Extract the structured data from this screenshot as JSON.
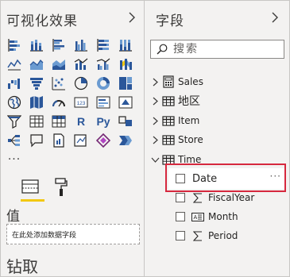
{
  "panels": {
    "visualizations_title": "可视化效果",
    "fields_title": "字段"
  },
  "visual_icons": [
    "stacked-bar-icon",
    "stacked-column-icon",
    "clustered-bar-icon",
    "clustered-column-icon",
    "100-percent-bar-icon",
    "100-percent-column-icon",
    "line-chart-icon",
    "area-chart-icon",
    "stacked-area-icon",
    "line-column-icon",
    "line-clustered-column-icon",
    "ribbon-chart-icon",
    "waterfall-icon",
    "funnel-icon",
    "scatter-icon",
    "pie-chart-icon",
    "donut-chart-icon",
    "treemap-icon",
    "map-icon",
    "filled-map-icon",
    "gauge-icon",
    "card-icon",
    "multi-row-card-icon",
    "kpi-icon",
    "slicer-icon",
    "table-icon",
    "matrix-icon",
    "r-visual",
    "python-visual",
    "key-influencers-icon",
    "decomposition-tree-icon",
    "qa-icon",
    "paginated-report-icon",
    "get-more-visuals-icon",
    "power-apps-icon",
    "smart-narrative-icon",
    "more-visuals"
  ],
  "visual_text": {
    "r": "R",
    "python": "Py",
    "more": "···",
    "card_number": "123"
  },
  "build_tabs": {
    "fields_tab_icon": "fields-tab-icon",
    "format_tab_icon": "paint-roller-icon",
    "active_underline_color": "#f2c811"
  },
  "values_section": {
    "label": "值",
    "drop_placeholder": "在此处添加数据字段"
  },
  "drillthrough_label": "钻取",
  "search": {
    "placeholder": "搜索"
  },
  "tables": [
    {
      "name": "Sales",
      "expanded": false
    },
    {
      "name": "地区",
      "expanded": false
    },
    {
      "name": "Item",
      "expanded": false
    },
    {
      "name": "Store",
      "expanded": false
    },
    {
      "name": "Time",
      "expanded": true
    }
  ],
  "time_fields": {
    "date": "Date",
    "date_more": "···",
    "fiscal_year": "FiscalYear",
    "month": "Month",
    "period": "Period"
  },
  "highlight_color": "#d6283e"
}
